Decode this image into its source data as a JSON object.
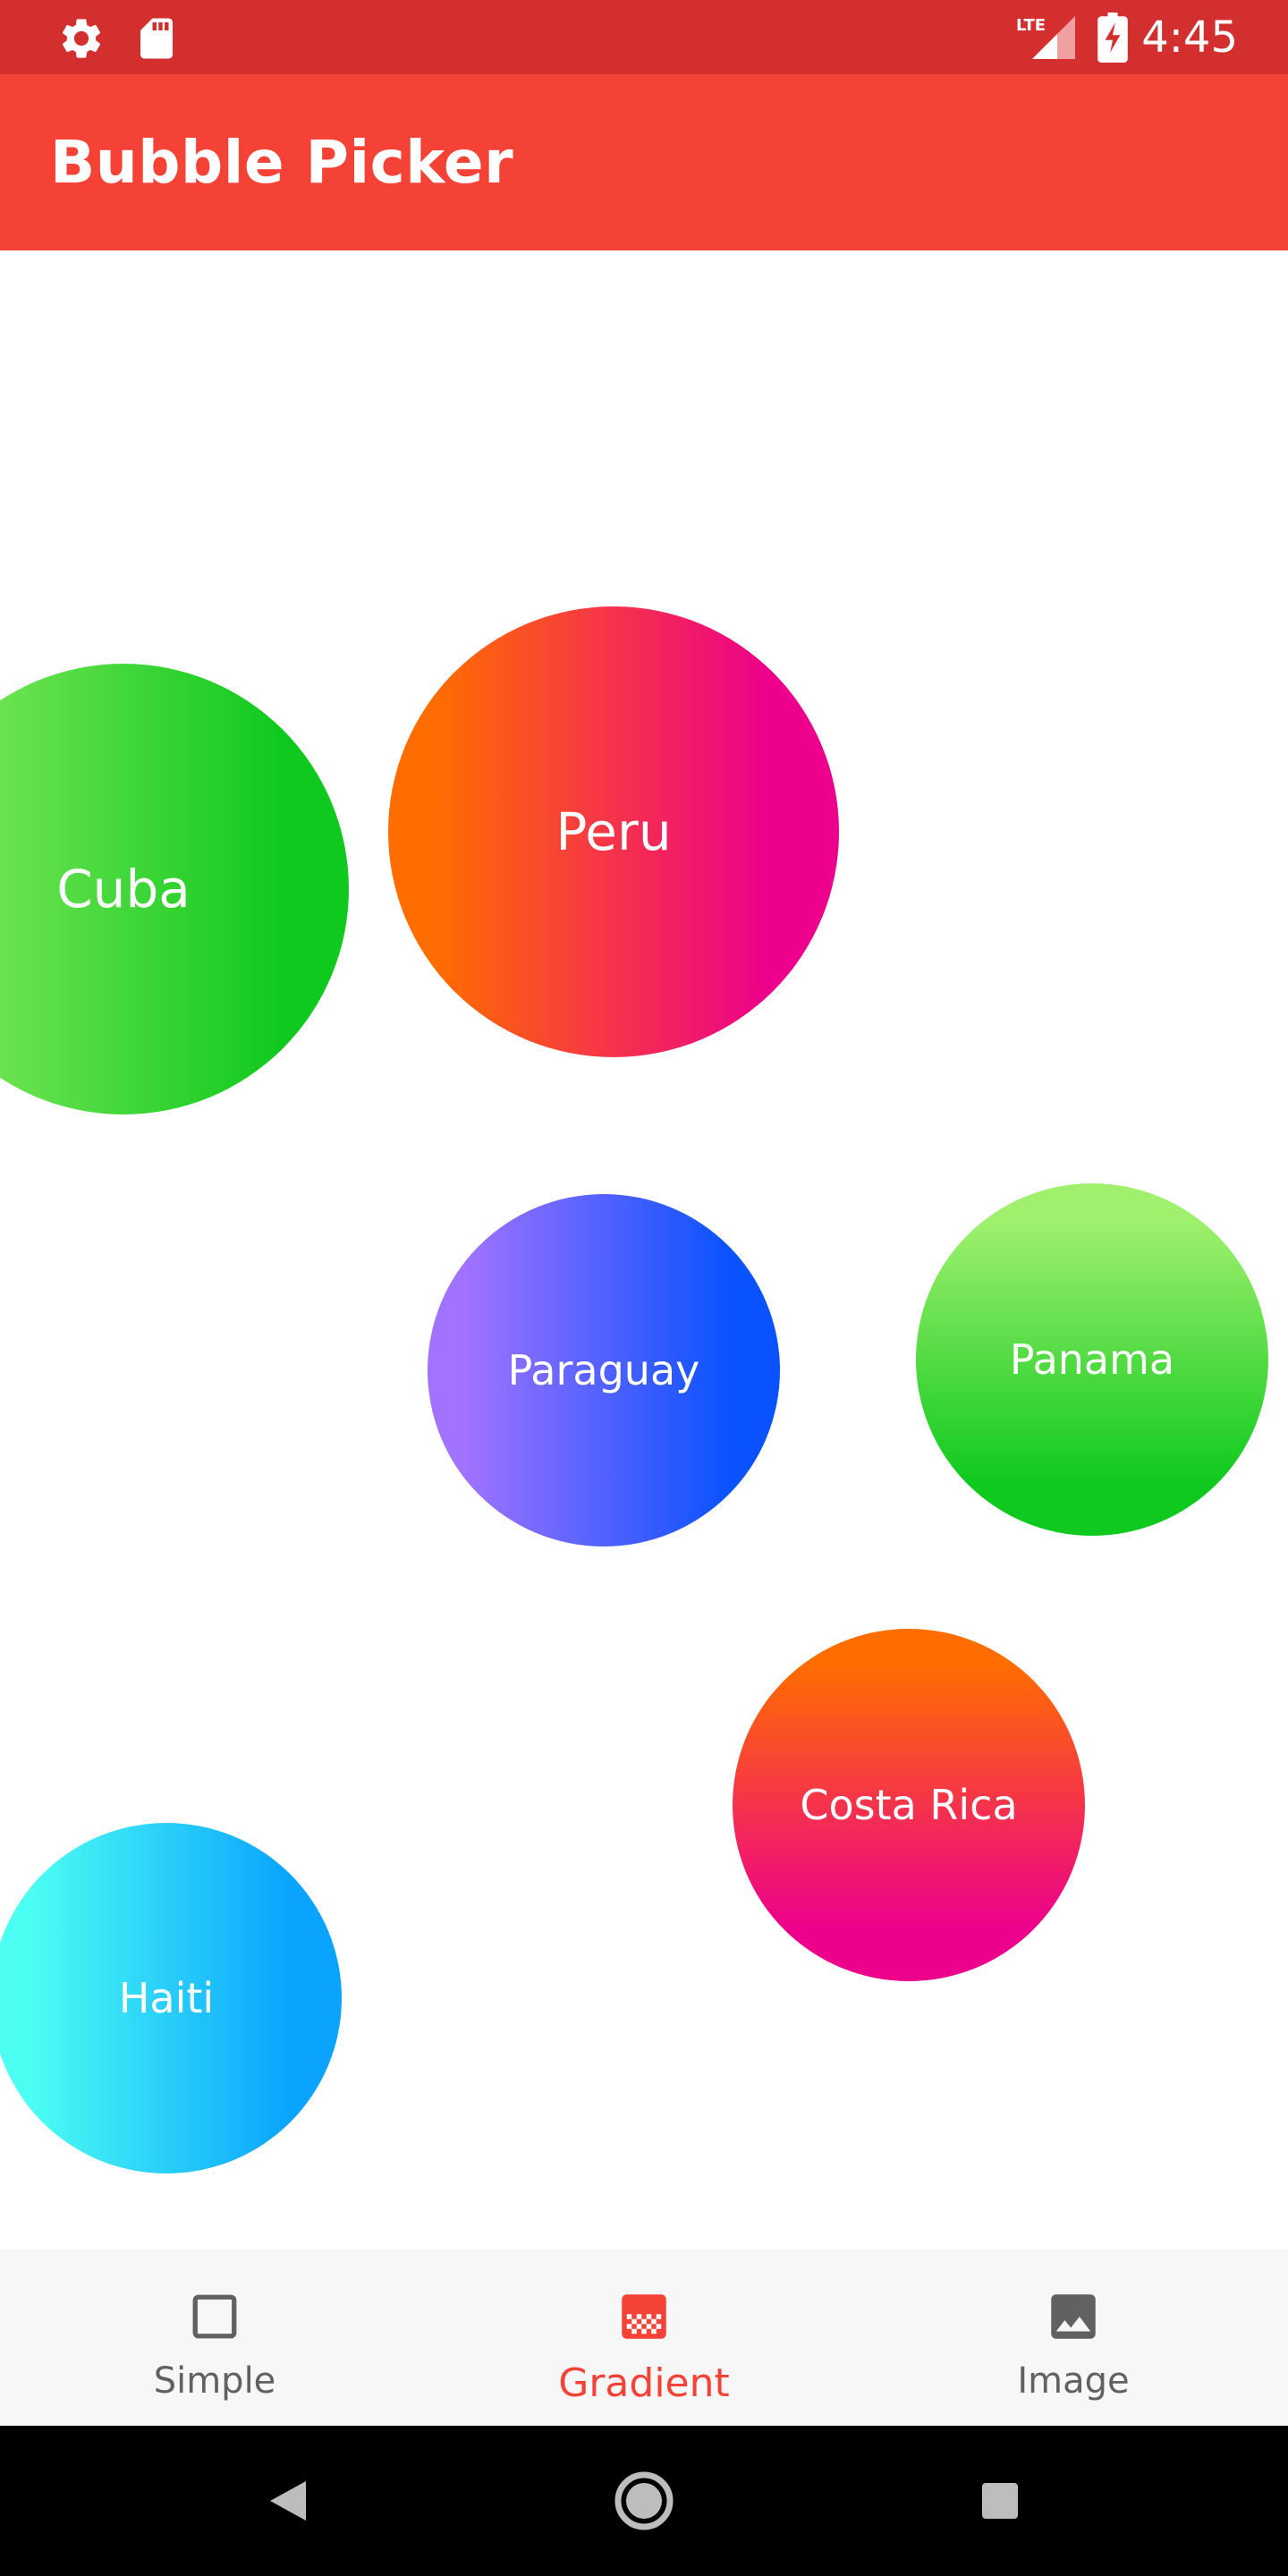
{
  "status_bar": {
    "time": "4:45",
    "network": "LTE",
    "bg_color": "#d32f2f",
    "icons": [
      "settings-icon",
      "sd-card-icon",
      "lte-signal-icon",
      "battery-charging-icon"
    ]
  },
  "app_bar": {
    "title": "Bubble Picker",
    "bg_color": "#f44336"
  },
  "bubbles": [
    {
      "label": "Cuba",
      "gradient": [
        "#7ee85a",
        "#0fc91e"
      ],
      "direction": "horizontal"
    },
    {
      "label": "Peru",
      "gradient": [
        "#ff6d00",
        "#ec008c"
      ],
      "direction": "horizontal"
    },
    {
      "label": "Paraguay",
      "gradient": [
        "#a173ff",
        "#0b52ff"
      ],
      "direction": "horizontal"
    },
    {
      "label": "Panama",
      "gradient": [
        "#a0f06e",
        "#0fc91e"
      ],
      "direction": "vertical"
    },
    {
      "label": "Costa Rica",
      "gradient": [
        "#ff6d00",
        "#ec008c"
      ],
      "direction": "vertical"
    },
    {
      "label": "Haiti",
      "gradient": [
        "#4dfff2",
        "#0aa4ff"
      ],
      "direction": "horizontal"
    }
  ],
  "bottom_nav": {
    "items": [
      {
        "label": "Simple",
        "icon": "square-outline-icon",
        "selected": false
      },
      {
        "label": "Gradient",
        "icon": "gradient-icon",
        "selected": true
      },
      {
        "label": "Image",
        "icon": "image-icon",
        "selected": false
      }
    ],
    "active_color": "#f44336",
    "inactive_color": "#616161"
  },
  "system_nav": {
    "buttons": [
      "back-icon",
      "home-icon",
      "recents-icon"
    ]
  }
}
